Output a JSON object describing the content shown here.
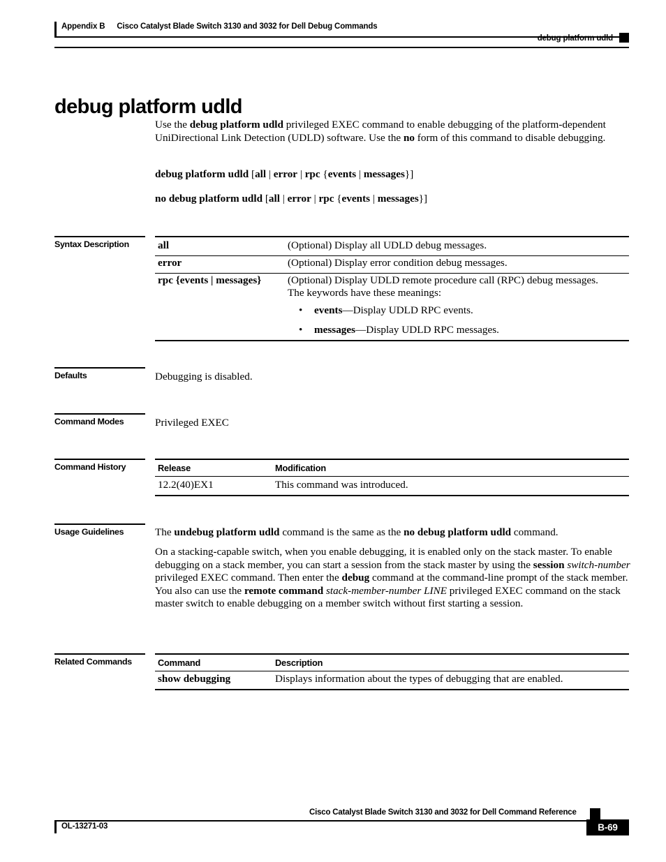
{
  "header": {
    "appendix": "Appendix B",
    "book": "Cisco Catalyst Blade Switch 3130 and 3032 for Dell Debug Commands",
    "running_head": "debug platform udld"
  },
  "title": "debug platform udld",
  "intro": {
    "p1_a": "Use the ",
    "p1_b": "debug platform udld",
    "p1_c": " privileged EXEC command to enable debugging of the platform-dependent UniDirectional Link Detection (UDLD) software. Use the ",
    "p1_d": "no",
    "p1_e": " form of this command to disable debugging."
  },
  "syntax_lines": {
    "line1_bold": "debug platform udld",
    "line1_rest": " [all | error | rpc {events | messages}]",
    "line1_parts": {
      "cmd": "debug platform udld",
      "ob": " [",
      "all": "all",
      "bar1": " | ",
      "error": "error",
      "bar2": " | ",
      "rpc": "rpc",
      "obrace": " {",
      "events": "events",
      "bar3": " | ",
      "messages": "messages",
      "cbrace": "}",
      "cb": "]"
    },
    "line2_parts": {
      "cmd": "no debug platform udld",
      "ob": " [",
      "all": "all",
      "bar1": " | ",
      "error": "error",
      "bar2": " | ",
      "rpc": "rpc",
      "obrace": " {",
      "events": "events",
      "bar3": " | ",
      "messages": "messages",
      "cbrace": "}",
      "cb": "]"
    }
  },
  "sections": {
    "syntax_description": "Syntax Description",
    "defaults": "Defaults",
    "command_modes": "Command Modes",
    "command_history": "Command History",
    "usage_guidelines": "Usage Guidelines",
    "related_commands": "Related Commands"
  },
  "syntax_table": {
    "rows": [
      {
        "term": "all",
        "desc": "(Optional) Display all UDLD debug messages."
      },
      {
        "term": "error",
        "desc": "(Optional) Display error condition debug messages."
      }
    ],
    "rpc_row": {
      "term_bold": "rpc",
      "term_rest": " {events | messages}",
      "term_parts": {
        "rpc": "rpc",
        "obrace": " {",
        "events": "events",
        "bar": " | ",
        "messages": "messages",
        "cbrace": "}"
      },
      "desc_line1": "(Optional) Display UDLD remote procedure call (RPC) debug messages.",
      "desc_line2": "The keywords have these meanings:",
      "bullets": [
        {
          "dot": "•",
          "term": "events",
          "text": "—Display UDLD RPC events."
        },
        {
          "dot": "•",
          "term": "messages",
          "text": "—Display UDLD RPC messages."
        }
      ]
    }
  },
  "defaults_text": "Debugging is disabled.",
  "command_modes_text": "Privileged EXEC",
  "command_history": {
    "col1_header": "Release",
    "col2_header": "Modification",
    "rows": [
      {
        "release": "12.2(40)EX1",
        "modification": "This command was introduced."
      }
    ]
  },
  "usage": {
    "p1_a": "The ",
    "p1_b": "undebug platform udld",
    "p1_c": " command is the same as the ",
    "p1_d": "no debug platform udld",
    "p1_e": " command.",
    "p2_a": "On a stacking-capable switch, when you enable debugging, it is enabled only on the stack master. To enable debugging on a stack member, you can start a session from the stack master by using the ",
    "p2_b": "session",
    "p2_c": " ",
    "p2_d": "switch-number",
    "p2_e": " privileged EXEC command. Then enter the ",
    "p2_f": "debug",
    "p2_g": " command at the command-line prompt of the stack member. You also can use the ",
    "p2_h": "remote command",
    "p2_i": " ",
    "p2_j": "stack-member-number LINE",
    "p2_k": " privileged EXEC command on the stack master switch to enable debugging on a member switch without first starting a session."
  },
  "related_commands": {
    "col1_header": "Command",
    "col2_header": "Description",
    "rows": [
      {
        "command": "show debugging",
        "description": "Displays information about the types of debugging that are enabled."
      }
    ]
  },
  "footer": {
    "doc_id": "OL-13271-03",
    "book_title": "Cisco Catalyst Blade Switch 3130 and 3032 for Dell Command Reference",
    "page_number": "B-69"
  }
}
